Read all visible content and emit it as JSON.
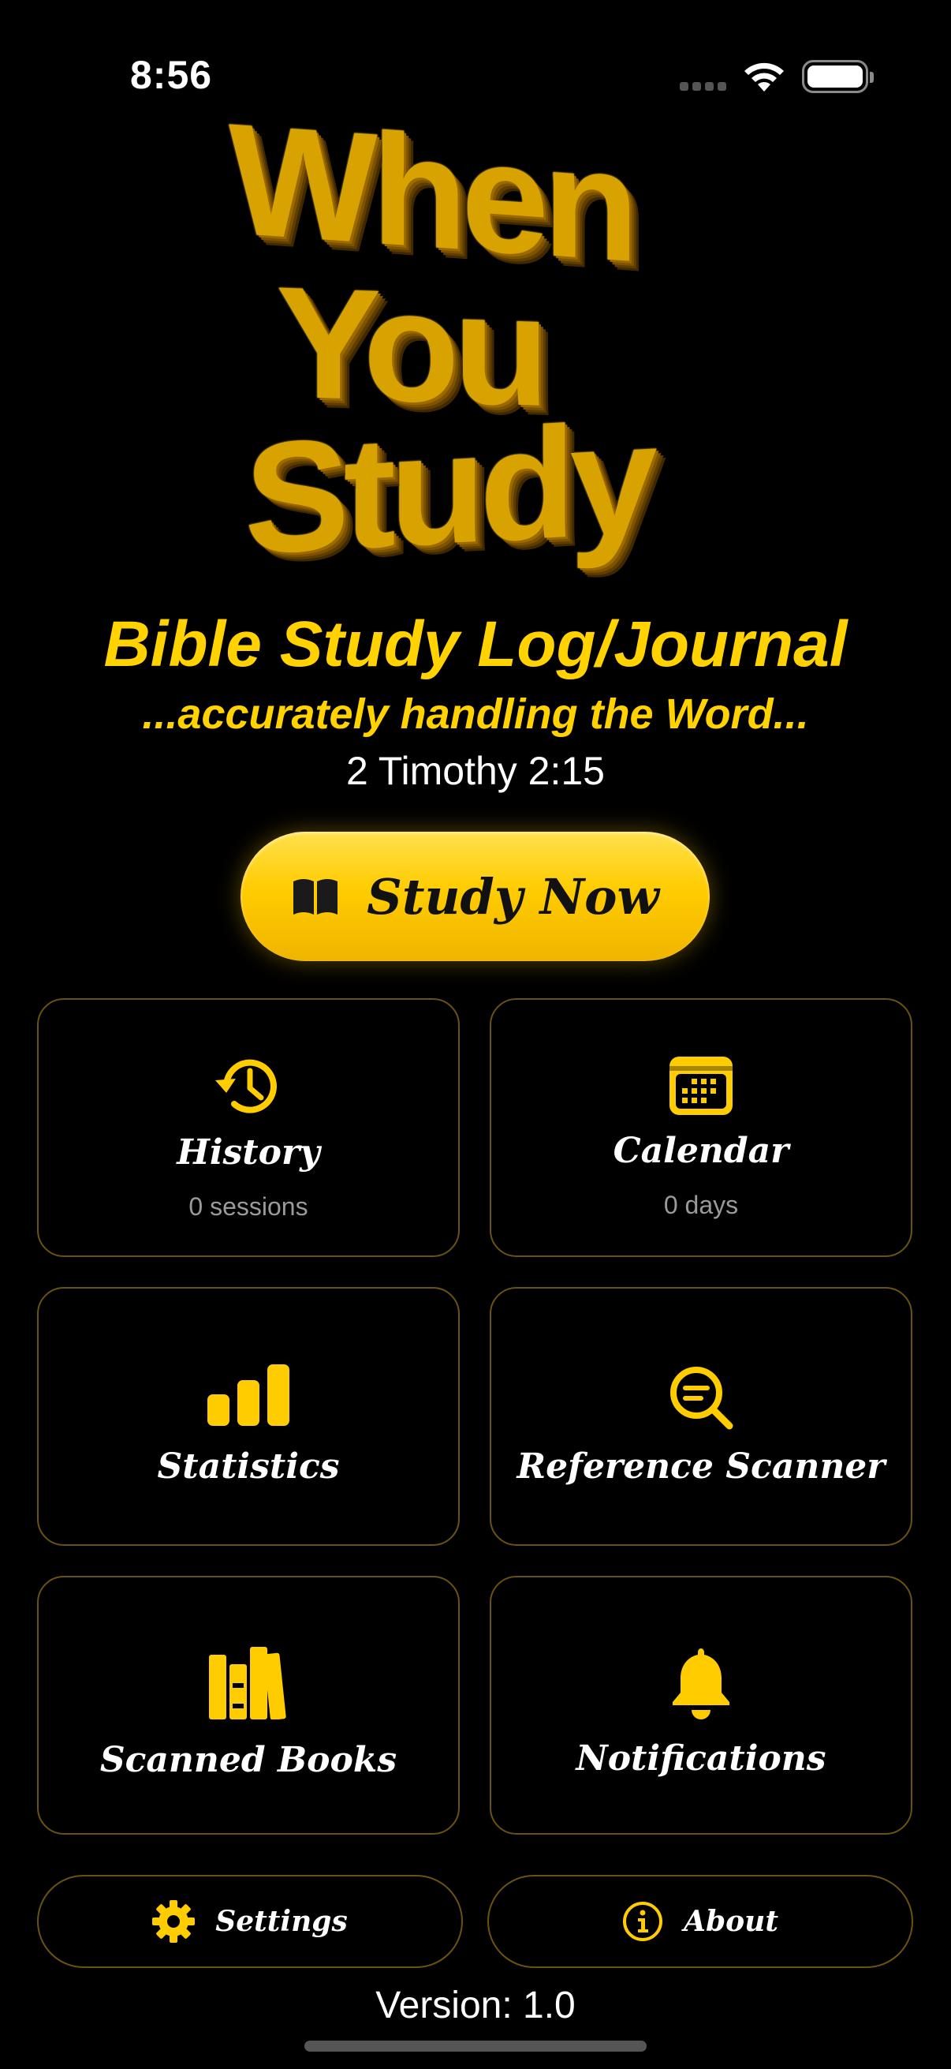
{
  "status_bar": {
    "time": "8:56"
  },
  "logo": {
    "line1": "When",
    "line2": "You",
    "line3": "Study"
  },
  "header": {
    "title": "Bible Study Log/Journal",
    "subtitle": "...accurately handling the Word...",
    "verse": "2 Timothy 2:15"
  },
  "study_now": {
    "label": "Study Now",
    "icon": "book-open-icon"
  },
  "tiles": {
    "history": {
      "title": "History",
      "sub": "0 sessions",
      "icon": "history-clock-icon"
    },
    "calendar": {
      "title": "Calendar",
      "sub": "0 days",
      "icon": "calendar-icon"
    },
    "statistics": {
      "title": "Statistics",
      "icon": "bar-chart-icon"
    },
    "reference_scanner": {
      "title": "Reference Scanner",
      "icon": "search-text-icon"
    },
    "scanned_books": {
      "title": "Scanned Books",
      "icon": "books-icon"
    },
    "notifications": {
      "title": "Notifications",
      "icon": "bell-icon"
    }
  },
  "footer": {
    "settings": {
      "label": "Settings",
      "icon": "gear-icon"
    },
    "about": {
      "label": "About",
      "icon": "info-icon"
    },
    "version": "Version: 1.0"
  },
  "colors": {
    "background": "#000000",
    "accent": "#FFCC00",
    "tile_border": "#6A5210",
    "muted_text": "#9A9A9A"
  }
}
